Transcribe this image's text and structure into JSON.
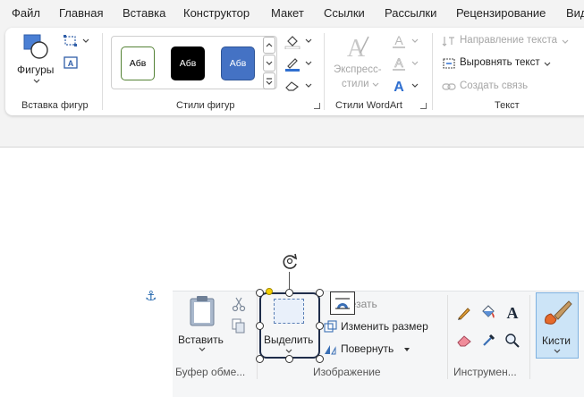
{
  "tabs": [
    {
      "label": "Файл"
    },
    {
      "label": "Главная"
    },
    {
      "label": "Вставка"
    },
    {
      "label": "Конструктор"
    },
    {
      "label": "Макет"
    },
    {
      "label": "Ссылки"
    },
    {
      "label": "Рассылки"
    },
    {
      "label": "Рецензирование"
    },
    {
      "label": "Вид"
    }
  ],
  "ribbon": {
    "insert_shapes": {
      "shapes_label": "Фигуры",
      "group_label": "Вставка фигур"
    },
    "shape_styles": {
      "gallery": [
        {
          "label": "Абв",
          "fill": "#ffffff",
          "border": "#548235",
          "text": "#000000"
        },
        {
          "label": "Абв",
          "fill": "#000000",
          "border": "#000000",
          "text": "#ffffff"
        },
        {
          "label": "Абв",
          "fill": "#4472c4",
          "border": "#2f5597",
          "text": "#ffffff"
        }
      ],
      "group_label": "Стили фигур"
    },
    "wordart": {
      "express_styles_line1": "Экспресс-",
      "express_styles_line2": "стили",
      "group_label": "Стили WordArt"
    },
    "text": {
      "direction_label": "Направление текста",
      "align_label": "Выровнять текст",
      "link_label": "Создать связь",
      "group_label": "Текст"
    }
  },
  "picture": {
    "clipboard": {
      "paste_label": "Вставить",
      "group_label": "Буфер обме..."
    },
    "image": {
      "select_label": "Выделить",
      "crop_label": "резать",
      "resize_label": "Изменить размер",
      "rotate_label": "Повернуть",
      "group_label": "Изображение"
    },
    "tools": {
      "group_label": "Инструмен..."
    },
    "brushes": {
      "label": "Кисти"
    }
  },
  "colors": {
    "ribbon_bg": "#f3f3f3",
    "accent_blue": "#4472c4",
    "selection_frame": "#1f2d4a",
    "handle_yellow": "#f5d000"
  }
}
